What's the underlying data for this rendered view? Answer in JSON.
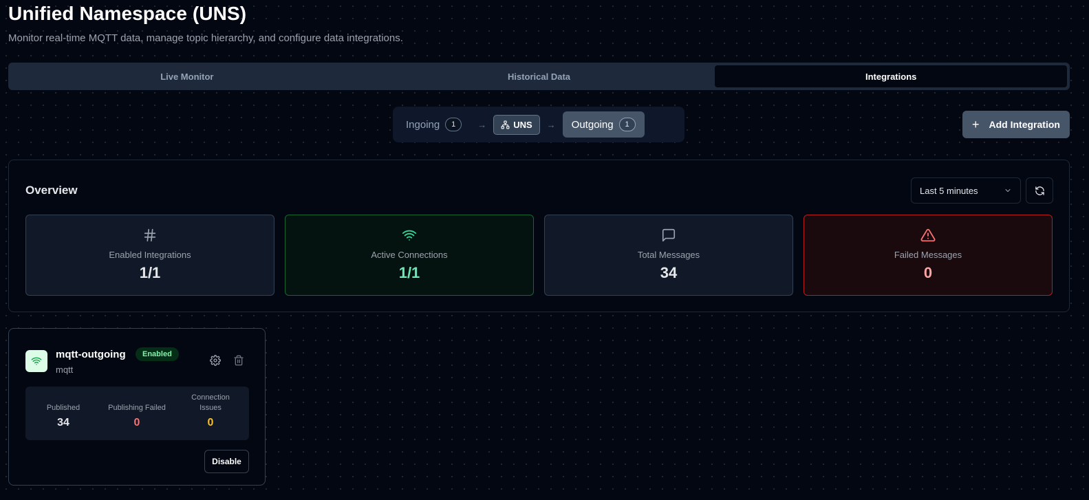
{
  "header": {
    "title": "Unified Namespace (UNS)",
    "subtitle": "Monitor real-time MQTT data, manage topic hierarchy, and configure data integrations."
  },
  "tabs": [
    {
      "label": "Live Monitor",
      "active": false
    },
    {
      "label": "Historical Data",
      "active": false
    },
    {
      "label": "Integrations",
      "active": true
    }
  ],
  "flow": {
    "ingoing_label": "Ingoing",
    "ingoing_count": "1",
    "uns_label": "UNS",
    "outgoing_label": "Outgoing",
    "outgoing_count": "1",
    "selected": "Outgoing"
  },
  "add_integration_label": "Add Integration",
  "overview": {
    "title": "Overview",
    "time_range": "Last 5 minutes",
    "stats": [
      {
        "label": "Enabled Integrations",
        "value": "1/1",
        "icon": "hash-icon"
      },
      {
        "label": "Active Connections",
        "value": "1/1",
        "icon": "wifi-icon"
      },
      {
        "label": "Total Messages",
        "value": "34",
        "icon": "message-icon"
      },
      {
        "label": "Failed Messages",
        "value": "0",
        "icon": "alert-triangle-icon"
      }
    ]
  },
  "integration": {
    "name": "mqtt-outgoing",
    "status": "Enabled",
    "type": "mqtt",
    "stats": [
      {
        "label": "Published",
        "value": "34"
      },
      {
        "label": "Publishing Failed",
        "value": "0"
      },
      {
        "label": "Connection Issues",
        "value": "0"
      }
    ],
    "disable_label": "Disable"
  },
  "colors": {
    "background": "#030712",
    "success": "#6ee7b7",
    "danger": "#f87171",
    "warning": "#fbbf24"
  }
}
